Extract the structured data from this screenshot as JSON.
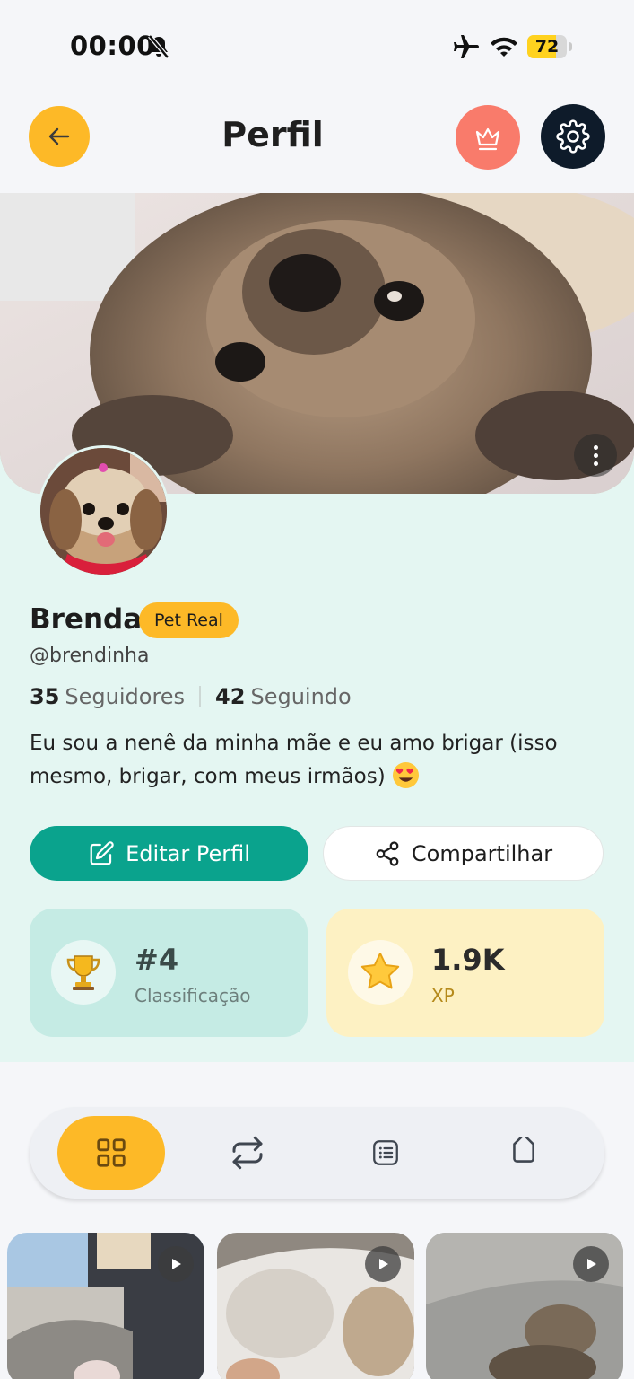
{
  "status_bar": {
    "time": "00:00",
    "battery_level": 72,
    "icons": [
      "bell-off-icon",
      "airplane-icon",
      "wifi-icon",
      "battery-icon"
    ]
  },
  "header": {
    "title": "Perfil",
    "back_icon": "arrow-left-icon",
    "crown_icon": "crown-icon",
    "settings_icon": "gear-icon"
  },
  "profile": {
    "name": "Brenda",
    "badge": "Pet Real",
    "handle": "@brendinha",
    "followers_count": "35",
    "followers_label": "Seguidores",
    "following_count": "42",
    "following_label": "Seguindo",
    "bio": "Eu sou a nenê da minha mãe e eu amo brigar (isso mesmo, brigar, com meus irmãos)"
  },
  "actions": {
    "edit_label": "Editar Perfil",
    "share_label": "Compartilhar"
  },
  "stats_cards": {
    "rank_value": "#4",
    "rank_label": "Classificação",
    "xp_value": "1.9K",
    "xp_label": "XP"
  },
  "tabs": [
    {
      "icon": "grid-icon",
      "active": true
    },
    {
      "icon": "repost-icon",
      "active": false
    },
    {
      "icon": "list-icon",
      "active": false
    },
    {
      "icon": "tag-icon",
      "active": false
    }
  ],
  "posts": [
    {
      "type": "video",
      "icon": "play-icon"
    },
    {
      "type": "video",
      "icon": "play-icon"
    },
    {
      "type": "video",
      "icon": "play-icon"
    }
  ],
  "colors": {
    "accent_yellow": "#FDB927",
    "accent_teal": "#0AA38D",
    "accent_coral": "#F97B6B",
    "dark_navy": "#0E1B2A",
    "profile_bg": "#E4F6F2"
  }
}
